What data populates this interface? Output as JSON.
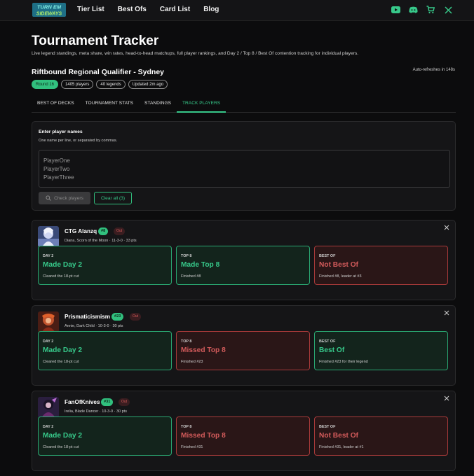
{
  "nav": {
    "logo_text": "TURN EM SIDEWAYS",
    "links": [
      "Tier List",
      "Best Ofs",
      "Card List",
      "Blog"
    ],
    "icons": [
      "youtube-icon",
      "discord-icon",
      "cart-icon",
      "x-icon"
    ]
  },
  "header": {
    "title": "Tournament Tracker",
    "subtitle": "Live legend standings, meta share, win rates, head-to-head matchups, full player rankings, and Day 2 / Top 8 / Best Of contention tracking for individual players.",
    "event": "Riftbound Regional Qualifier - Sydney",
    "refresh": "Auto-refreshes in 148s",
    "pills": [
      "Round 16",
      "1405 players",
      "40 legends",
      "Updated 2m ago"
    ]
  },
  "tabs": [
    "BEST OF DECKS",
    "TOURNAMENT STATS",
    "STANDINGS",
    "TRACK PLAYERS"
  ],
  "active_tab": "TRACK PLAYERS",
  "tracker": {
    "title": "Enter player names",
    "hint": "One name per line, or separated by commas.",
    "placeholder": "PlayerOne\nPlayerTwo\nPlayerThree",
    "check_label": "Check players",
    "clear_label": "Clear all (3)"
  },
  "colors": {
    "accent": "#31c07e",
    "good_border": "#2aa872",
    "bad_border": "#a83a3a",
    "bad_text": "#d35b5b"
  },
  "players": [
    {
      "name": "CTG Alanzq",
      "rank": "#8",
      "status": "Out",
      "meta": "Diana, Scorn of the Moon · 11-3-0 · 33 pts",
      "boxes": [
        {
          "label": "DAY 2",
          "value": "Made Day 2",
          "detail": "Cleared the 18-pt cut",
          "state": "good"
        },
        {
          "label": "TOP 8",
          "value": "Made Top 8",
          "detail": "Finished #8",
          "state": "good"
        },
        {
          "label": "BEST OF",
          "value": "Not Best Of",
          "detail": "Finished #8, leader at #3",
          "state": "bad"
        }
      ]
    },
    {
      "name": "Prismaticismism",
      "rank": "#23",
      "status": "Out",
      "meta": "Annie, Dark Child · 10-3-0 · 30 pts",
      "boxes": [
        {
          "label": "DAY 2",
          "value": "Made Day 2",
          "detail": "Cleared the 18-pt cut",
          "state": "good"
        },
        {
          "label": "TOP 8",
          "value": "Missed Top 8",
          "detail": "Finished #23",
          "state": "bad"
        },
        {
          "label": "BEST OF",
          "value": "Best Of",
          "detail": "Finished #23 for their legend",
          "state": "good"
        }
      ]
    },
    {
      "name": "FanOfKnives",
      "rank": "#31",
      "status": "Out",
      "meta": "Irelia, Blade Dancer · 10-3-0 · 30 pts",
      "boxes": [
        {
          "label": "DAY 2",
          "value": "Made Day 2",
          "detail": "Cleared the 18-pt cut",
          "state": "good"
        },
        {
          "label": "TOP 8",
          "value": "Missed Top 8",
          "detail": "Finished #31",
          "state": "bad"
        },
        {
          "label": "BEST OF",
          "value": "Not Best Of",
          "detail": "Finished #31, leader at #1",
          "state": "bad"
        }
      ]
    }
  ]
}
